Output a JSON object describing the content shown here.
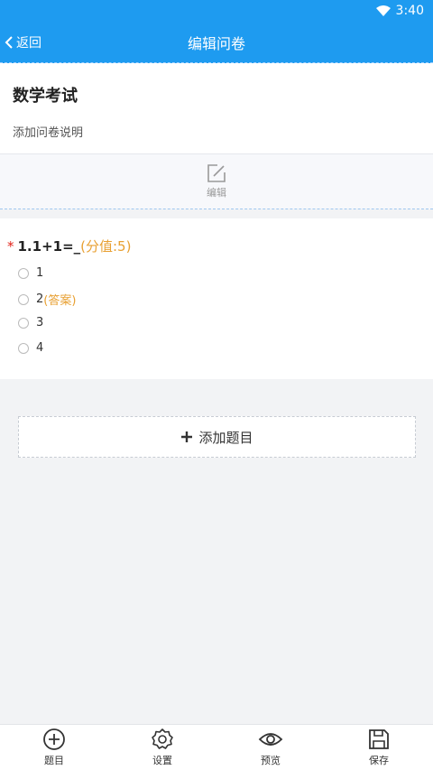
{
  "status_bar": {
    "time": "3:40",
    "wifi_icon": "wifi-icon"
  },
  "app_bar": {
    "back_label": "返回",
    "title": "编辑问卷"
  },
  "survey": {
    "title": "数学考试",
    "description_placeholder": "添加问卷说明"
  },
  "edit_block": {
    "label": "编辑"
  },
  "question": {
    "required_mark": "*",
    "stem": "1.1+1=_",
    "score_text": "(分值:5)",
    "options": [
      {
        "label": "1",
        "answer_tag": ""
      },
      {
        "label": "2",
        "answer_tag": "(答案)"
      },
      {
        "label": "3",
        "answer_tag": ""
      },
      {
        "label": "4",
        "answer_tag": ""
      }
    ]
  },
  "add_question": {
    "label": "添加题目"
  },
  "bottom_nav": {
    "items": [
      {
        "label": "题目",
        "icon": "plus-circle-icon"
      },
      {
        "label": "设置",
        "icon": "gear-icon"
      },
      {
        "label": "预览",
        "icon": "eye-icon"
      },
      {
        "label": "保存",
        "icon": "save-icon"
      }
    ]
  },
  "colors": {
    "primary": "#1e9bf0",
    "score": "#e8a032",
    "required": "#e2231a"
  }
}
